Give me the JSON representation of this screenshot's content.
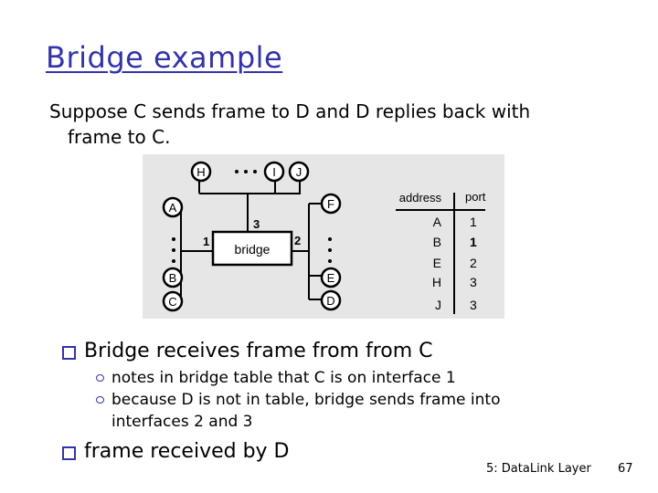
{
  "slide": {
    "title": "Bridge example",
    "intro_line1": "Suppose C sends frame to D and D replies back with",
    "intro_line2": "frame to C.",
    "bullets": [
      {
        "text": "Bridge receives frame from from C",
        "subs": [
          "notes in bridge table that C is on interface 1",
          "because D is not in table, bridge sends frame into",
          "interfaces 2 and 3"
        ]
      },
      {
        "text": "frame received by D"
      }
    ],
    "footer_chapter": "5: DataLink Layer",
    "footer_page": "67"
  },
  "diagram": {
    "bridge_label": "bridge",
    "port_labels": [
      "1",
      "2",
      "3"
    ],
    "hosts": [
      "A",
      "B",
      "C",
      "D",
      "E",
      "F",
      "H",
      "I",
      "J"
    ],
    "ellipsis": "• • •"
  },
  "table": {
    "headers": [
      "address",
      "port"
    ],
    "rows": [
      [
        "A",
        "1"
      ],
      [
        "B",
        "1"
      ],
      [
        "E",
        "2"
      ],
      [
        "H",
        "3"
      ],
      [
        "J",
        "3"
      ]
    ]
  },
  "colors": {
    "title": "#3333aa",
    "bullet": "#3333aa",
    "figure_bg": "#e6e6e6"
  }
}
